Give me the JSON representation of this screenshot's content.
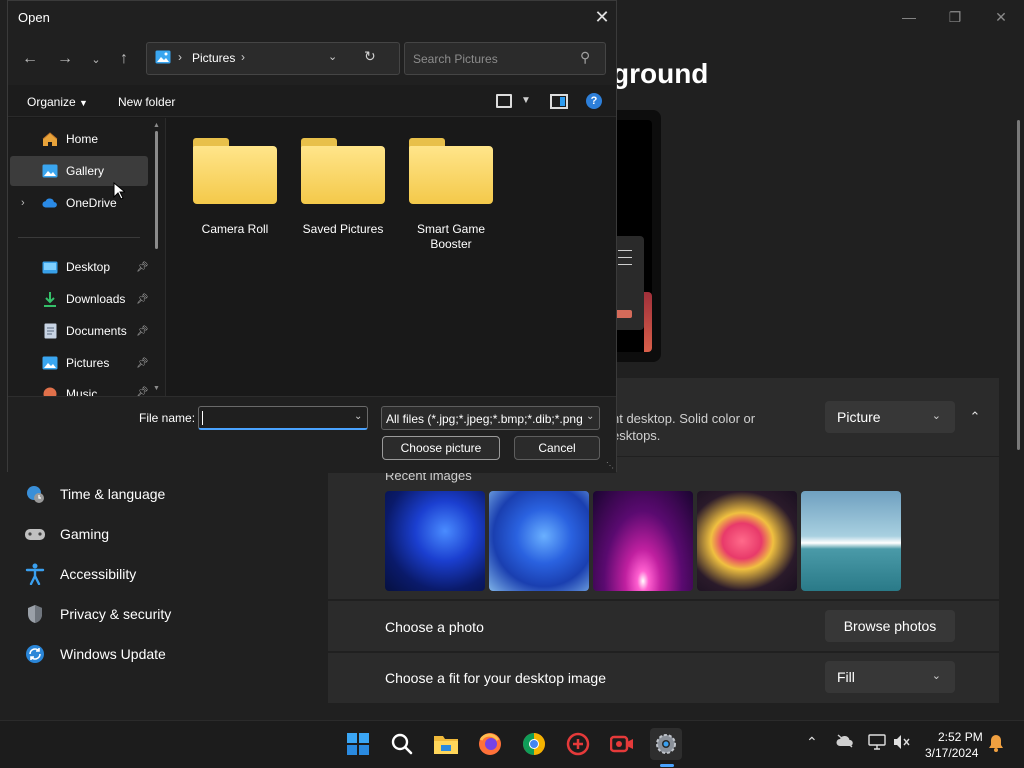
{
  "settings_window": {
    "page_title_fragment": "ground",
    "personalize_desc_line1": "nt desktop. Solid color or",
    "personalize_desc_line2": "esktops.",
    "background_type_value": "Picture",
    "recent_images_label": "Recent images",
    "choose_photo_label": "Choose a photo",
    "browse_photos_label": "Browse photos",
    "fit_label": "Choose a fit for your desktop image",
    "fit_value": "Fill",
    "nav_items": [
      {
        "label": "Time & language",
        "icon": "globe-clock-icon"
      },
      {
        "label": "Gaming",
        "icon": "gamepad-icon"
      },
      {
        "label": "Accessibility",
        "icon": "accessibility-icon"
      },
      {
        "label": "Privacy & security",
        "icon": "shield-icon"
      },
      {
        "label": "Windows Update",
        "icon": "update-icon"
      }
    ]
  },
  "dialog": {
    "title": "Open",
    "address": {
      "location": "Pictures"
    },
    "search_placeholder": "Search Pictures",
    "toolbar": {
      "organize": "Organize",
      "new_folder": "New folder"
    },
    "sidebar": [
      {
        "label": "Home",
        "icon": "home-icon"
      },
      {
        "label": "Gallery",
        "icon": "gallery-icon"
      },
      {
        "label": "OneDrive",
        "icon": "cloud-icon"
      },
      {
        "label": "Desktop",
        "icon": "desktop-icon",
        "pinned": true
      },
      {
        "label": "Downloads",
        "icon": "download-icon",
        "pinned": true
      },
      {
        "label": "Documents",
        "icon": "document-icon",
        "pinned": true
      },
      {
        "label": "Pictures",
        "icon": "pictures-icon",
        "pinned": true
      },
      {
        "label": "Music",
        "icon": "music-icon",
        "pinned": true
      }
    ],
    "folders": [
      {
        "name": "Camera Roll"
      },
      {
        "name": "Saved Pictures"
      },
      {
        "name": "Smart Game Booster"
      }
    ],
    "file_name_label": "File name:",
    "file_name_value": "",
    "file_type_value": "All files (*.jpg;*.jpeg;*.bmp;*.dib;*.png",
    "choose_button": "Choose picture",
    "cancel_button": "Cancel"
  },
  "taskbar": {
    "apps": [
      "start-icon",
      "search-icon",
      "file-explorer-icon",
      "firefox-icon",
      "chrome-icon",
      "game-booster-icon",
      "recorder-icon",
      "settings-icon"
    ],
    "time": "2:52 PM",
    "date": "3/17/2024"
  },
  "colors": {
    "accent": "#4aa3ff",
    "folder": "#f4c94a",
    "dialog_bg": "#191919",
    "window_bg": "#202020"
  }
}
